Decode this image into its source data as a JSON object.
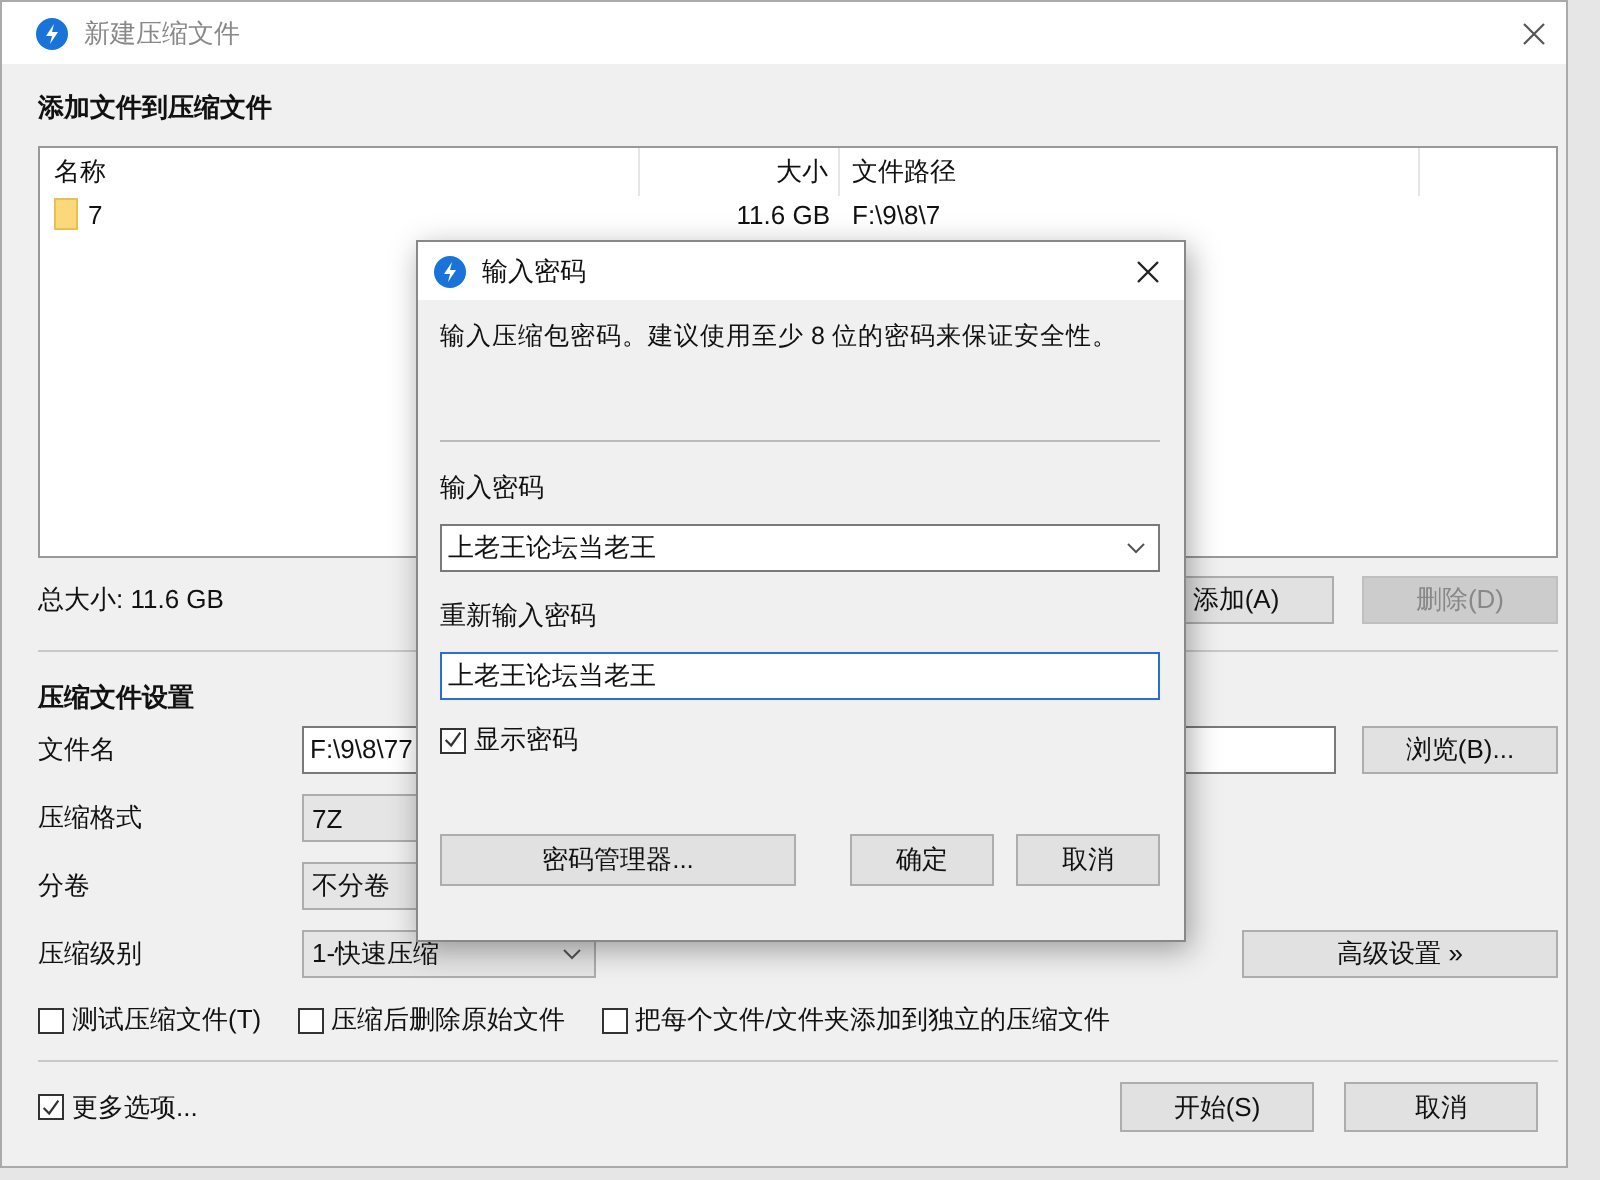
{
  "window": {
    "title": "新建压缩文件"
  },
  "files_section": {
    "title": "添加文件到压缩文件",
    "columns": [
      "名称",
      "大小",
      "文件路径"
    ],
    "rows": [
      {
        "name": "7",
        "size": "11.6 GB",
        "path": "F:\\9\\8\\7"
      }
    ],
    "total": "总大小: 11.6 GB",
    "buttons": [
      {
        "label": "添加(A)",
        "disabled": false
      },
      {
        "label": "删除(D)",
        "disabled": true
      }
    ]
  },
  "settings": {
    "title": "压缩文件设置",
    "fields": [
      {
        "label": "文件名",
        "kind": "text",
        "value": "F:\\9\\8\\77",
        "button": "浏览(B)..."
      },
      {
        "label": "压缩格式",
        "kind": "select",
        "value": "7Z"
      },
      {
        "label": "分卷",
        "kind": "select",
        "value": "不分卷"
      },
      {
        "label": "压缩级别",
        "kind": "dropdown",
        "value": "1-快速压缩",
        "button": "高级设置 »"
      }
    ],
    "options": [
      {
        "label": "测试压缩文件(T)",
        "checked": false
      },
      {
        "label": "压缩后删除原始文件",
        "checked": false
      },
      {
        "label": "把每个文件/文件夹添加到独立的压缩文件",
        "checked": false
      }
    ]
  },
  "more_options": {
    "label": "更多选项...",
    "checked": true
  },
  "buttons": [
    "开始(S)",
    "取消"
  ],
  "password_dialog": {
    "title": "输入密码",
    "message": "输入压缩包密码。建议使用至少 8 位的密码来保证安全性。",
    "password_label": "输入密码",
    "password": "上老王论坛当老王",
    "confirm_label": "重新输入密码",
    "confirm": "上老王论坛当老王",
    "show_password": {
      "label": "显示密码",
      "checked": true
    },
    "manager_button": "密码管理器...",
    "buttons": [
      "确定",
      "取消"
    ]
  }
}
